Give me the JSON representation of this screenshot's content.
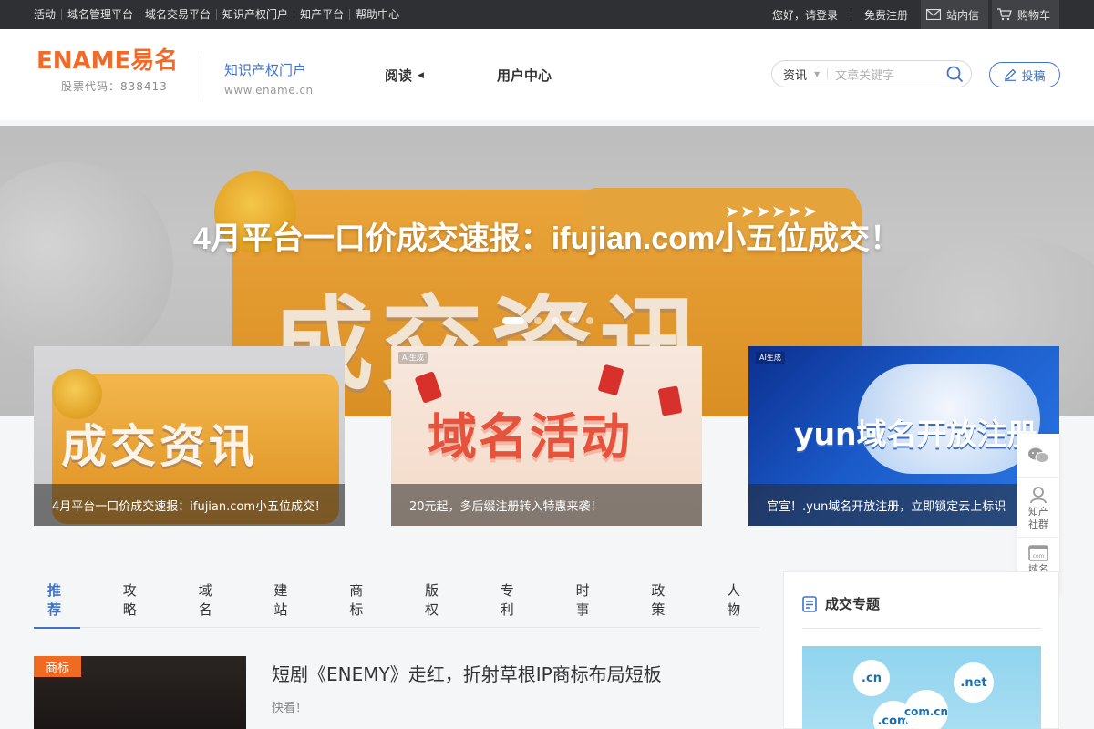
{
  "topbar": {
    "links": [
      "活动",
      "域名管理平台",
      "域名交易平台",
      "知识产权门户",
      "知产平台",
      "帮助中心"
    ],
    "greeting": "您好，请登录",
    "register": "免费注册",
    "messages": "站内信",
    "cart": "购物车"
  },
  "header": {
    "logo_text": "ENAME易名",
    "stock_code": "股票代码：838413",
    "portal_title": "知识产权门户",
    "portal_url": "www.ename.cn",
    "nav": [
      {
        "label": "阅读",
        "has_dropdown": true
      },
      {
        "label": "用户中心",
        "has_dropdown": false
      }
    ],
    "search_category": "资讯",
    "search_placeholder": "文章关键字",
    "submit_label": "投稿"
  },
  "hero": {
    "title": "4月平台一口价成交速报：ifujian.com小五位成交！",
    "image_text": "成交资讯",
    "slide_count": 5,
    "active_slide": 1
  },
  "features": [
    {
      "image_text": "成交资讯",
      "caption": "4月平台一口价成交速报：ifujian.com小五位成交！",
      "ai_label": ""
    },
    {
      "image_text": "域名活动",
      "caption": "20元起，多后缀注册转入特惠来袭！",
      "ai_label": "AI生成"
    },
    {
      "image_text": "yun域名开放注册",
      "caption": "官宣！.yun域名开放注册，立即锁定云上标识",
      "ai_label": "AI生成"
    }
  ],
  "float_toolbar": [
    {
      "icon": "wechat-icon",
      "label": ""
    },
    {
      "icon": "community-icon",
      "label": "知产社群"
    },
    {
      "icon": "domain-community-icon",
      "label": "域名社群"
    }
  ],
  "category_tabs": [
    "推荐",
    "攻略",
    "域名",
    "建站",
    "商标",
    "版权",
    "专利",
    "时事",
    "政策",
    "人物"
  ],
  "active_tab": 0,
  "article": {
    "tag": "商标",
    "title": "短剧《ENEMY》走红，折射草根IP商标布局短板",
    "subtitle": "快看！"
  },
  "sidebar": {
    "title": "成交专题",
    "image_bubbles": [
      ".cn",
      ".net",
      ".com",
      "com.cn"
    ]
  },
  "colors": {
    "accent": "#3f73c9",
    "brand_orange": "#f06a2a",
    "topbar_bg": "#2f3033",
    "tag_orange": "#f16a21"
  }
}
